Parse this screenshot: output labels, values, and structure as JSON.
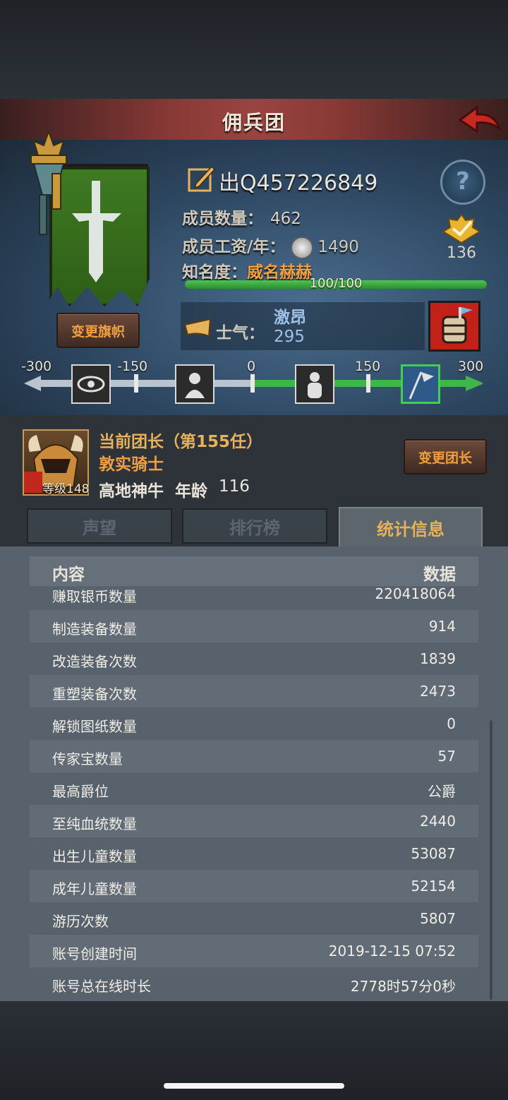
{
  "header": {
    "title": "佣兵团"
  },
  "guild": {
    "name": "出Q457226849",
    "members_label": "成员数量：",
    "members_value": "462",
    "wage_label": "成员工资/年：",
    "wage_value": "1490",
    "fame_label": "知名度：",
    "fame_value": "威名赫赫",
    "fame_progress_text": "100/100",
    "fame_progress": 1.0,
    "rank_value": "136",
    "change_banner_label": "变更旗帜",
    "help_symbol": "?",
    "morale_label": "士气：",
    "morale_state": "激昂",
    "morale_value": "295"
  },
  "morale_scale": {
    "ticks": [
      "-300",
      "-150",
      "0",
      "150",
      "300"
    ],
    "range": [
      -300,
      300
    ],
    "current": 295,
    "active_color": "#3fb64a"
  },
  "commander": {
    "title": "当前团长（第155任）",
    "name": "敦实骑士",
    "race": "高地神牛",
    "age_label": "年龄",
    "age": "116",
    "level": "等级148",
    "change_label": "变更团长"
  },
  "tabs": [
    {
      "label": "声望",
      "active": false
    },
    {
      "label": "排行榜",
      "active": false
    },
    {
      "label": "统计信息",
      "active": true
    }
  ],
  "stats": {
    "header_label": "内容",
    "header_value": "数据",
    "rows": [
      {
        "label": "赚取银币数量",
        "value": "220418064"
      },
      {
        "label": "制造装备数量",
        "value": "914"
      },
      {
        "label": "改造装备次数",
        "value": "1839"
      },
      {
        "label": "重塑装备次数",
        "value": "2473"
      },
      {
        "label": "解锁图纸数量",
        "value": "0"
      },
      {
        "label": "传家宝数量",
        "value": "57"
      },
      {
        "label": "最高爵位",
        "value": "公爵"
      },
      {
        "label": "至纯血统数量",
        "value": "2440"
      },
      {
        "label": "出生儿童数量",
        "value": "53087"
      },
      {
        "label": "成年儿童数量",
        "value": "52154"
      },
      {
        "label": "游历次数",
        "value": "5807"
      },
      {
        "label": "账号创建时间",
        "value": "2019-12-15 07:52"
      },
      {
        "label": "账号总在线时长",
        "value": "2778时57分0秒"
      }
    ]
  },
  "colors": {
    "accent_orange": "#f0a040",
    "title_red": "#8a3a36",
    "banner_green": "#3f7a23",
    "morale_blue": "#9fc0e8"
  },
  "icons": {
    "back": "back-arrow-icon",
    "edit": "edit-pen-icon",
    "help": "help-icon",
    "coin": "silver-coin-icon",
    "rank": "rank-badge-icon",
    "horn": "horn-icon",
    "morale_event": "barrel-event-icon"
  }
}
